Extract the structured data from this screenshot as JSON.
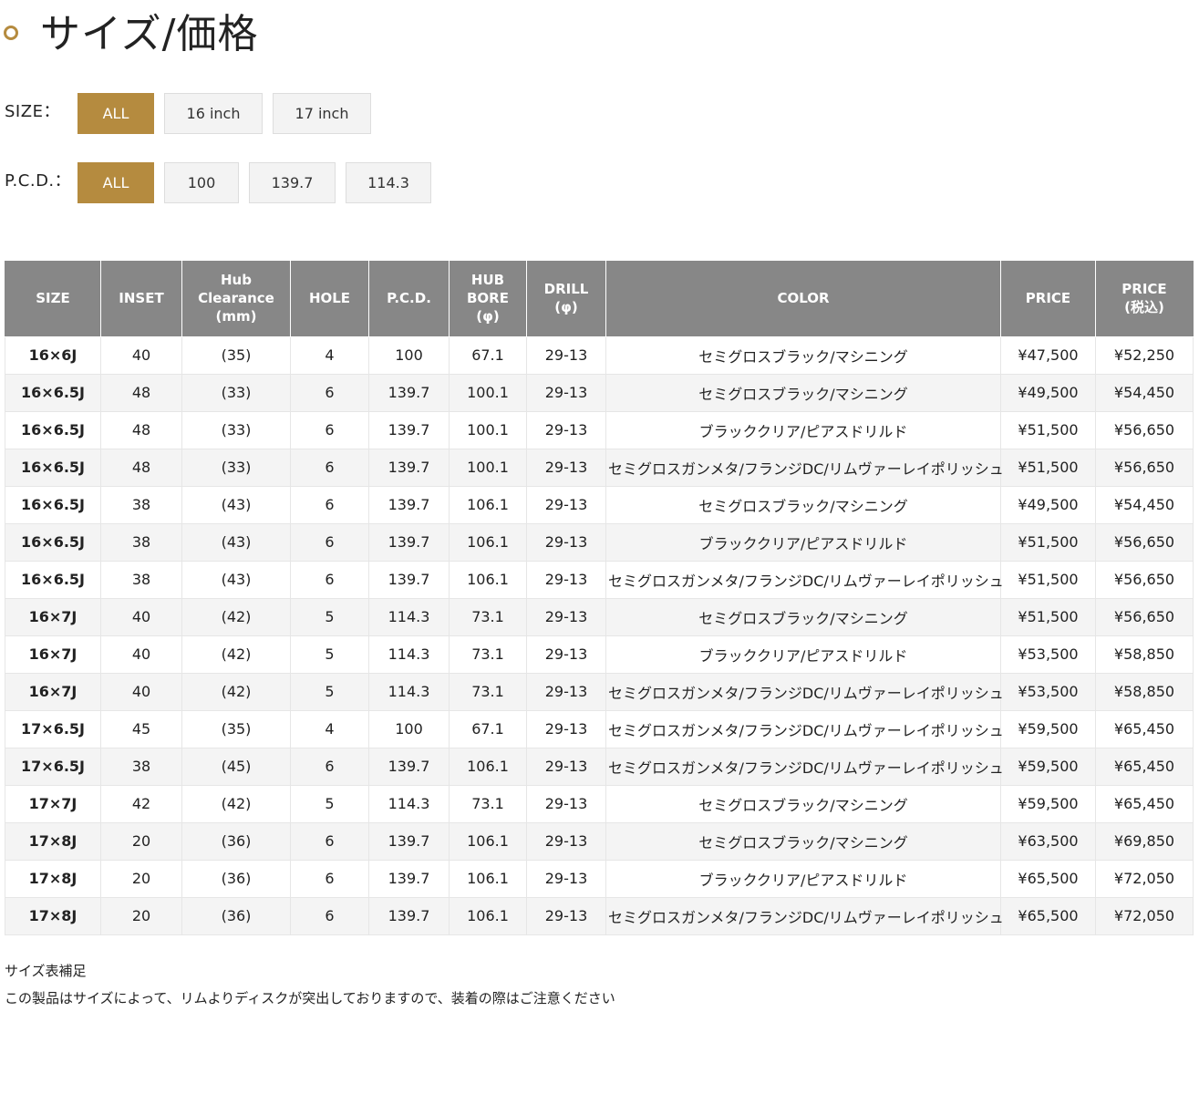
{
  "heading": {
    "icon": "circle-ring-icon",
    "title": "サイズ/価格"
  },
  "accent_color": "#b58b3f",
  "header_color": "#878787",
  "filters": {
    "size": {
      "label": "SIZE：",
      "options": [
        "ALL",
        "16 inch",
        "17 inch"
      ],
      "selected": "ALL"
    },
    "pcd": {
      "label": "P.C.D.：",
      "options": [
        "ALL",
        "100",
        "139.7",
        "114.3"
      ],
      "selected": "ALL"
    }
  },
  "table": {
    "headers": [
      [
        "SIZE"
      ],
      [
        "INSET"
      ],
      [
        "Hub",
        "Clearance",
        "(mm)"
      ],
      [
        "HOLE"
      ],
      [
        "P.C.D."
      ],
      [
        "HUB",
        "BORE",
        "(φ)"
      ],
      [
        "DRILL",
        "(φ)"
      ],
      [
        "COLOR"
      ],
      [
        "PRICE"
      ],
      [
        "PRICE",
        "(税込)"
      ]
    ],
    "rows": [
      [
        "16×6J",
        "40",
        "(35)",
        "4",
        "100",
        "67.1",
        "29-13",
        "セミグロスブラック/マシニング",
        "¥47,500",
        "¥52,250"
      ],
      [
        "16×6.5J",
        "48",
        "(33)",
        "6",
        "139.7",
        "100.1",
        "29-13",
        "セミグロスブラック/マシニング",
        "¥49,500",
        "¥54,450"
      ],
      [
        "16×6.5J",
        "48",
        "(33)",
        "6",
        "139.7",
        "100.1",
        "29-13",
        "ブラッククリア/ピアスドリルド",
        "¥51,500",
        "¥56,650"
      ],
      [
        "16×6.5J",
        "48",
        "(33)",
        "6",
        "139.7",
        "100.1",
        "29-13",
        "セミグロスガンメタ/フランジDC/リムヴァーレイポリッシュ",
        "¥51,500",
        "¥56,650"
      ],
      [
        "16×6.5J",
        "38",
        "(43)",
        "6",
        "139.7",
        "106.1",
        "29-13",
        "セミグロスブラック/マシニング",
        "¥49,500",
        "¥54,450"
      ],
      [
        "16×6.5J",
        "38",
        "(43)",
        "6",
        "139.7",
        "106.1",
        "29-13",
        "ブラッククリア/ピアスドリルド",
        "¥51,500",
        "¥56,650"
      ],
      [
        "16×6.5J",
        "38",
        "(43)",
        "6",
        "139.7",
        "106.1",
        "29-13",
        "セミグロスガンメタ/フランジDC/リムヴァーレイポリッシュ",
        "¥51,500",
        "¥56,650"
      ],
      [
        "16×7J",
        "40",
        "(42)",
        "5",
        "114.3",
        "73.1",
        "29-13",
        "セミグロスブラック/マシニング",
        "¥51,500",
        "¥56,650"
      ],
      [
        "16×7J",
        "40",
        "(42)",
        "5",
        "114.3",
        "73.1",
        "29-13",
        "ブラッククリア/ピアスドリルド",
        "¥53,500",
        "¥58,850"
      ],
      [
        "16×7J",
        "40",
        "(42)",
        "5",
        "114.3",
        "73.1",
        "29-13",
        "セミグロスガンメタ/フランジDC/リムヴァーレイポリッシュ",
        "¥53,500",
        "¥58,850"
      ],
      [
        "17×6.5J",
        "45",
        "(35)",
        "4",
        "100",
        "67.1",
        "29-13",
        "セミグロスガンメタ/フランジDC/リムヴァーレイポリッシュ",
        "¥59,500",
        "¥65,450"
      ],
      [
        "17×6.5J",
        "38",
        "(45)",
        "6",
        "139.7",
        "106.1",
        "29-13",
        "セミグロスガンメタ/フランジDC/リムヴァーレイポリッシュ",
        "¥59,500",
        "¥65,450"
      ],
      [
        "17×7J",
        "42",
        "(42)",
        "5",
        "114.3",
        "73.1",
        "29-13",
        "セミグロスブラック/マシニング",
        "¥59,500",
        "¥65,450"
      ],
      [
        "17×8J",
        "20",
        "(36)",
        "6",
        "139.7",
        "106.1",
        "29-13",
        "セミグロスブラック/マシニング",
        "¥63,500",
        "¥69,850"
      ],
      [
        "17×8J",
        "20",
        "(36)",
        "6",
        "139.7",
        "106.1",
        "29-13",
        "ブラッククリア/ピアスドリルド",
        "¥65,500",
        "¥72,050"
      ],
      [
        "17×8J",
        "20",
        "(36)",
        "6",
        "139.7",
        "106.1",
        "29-13",
        "セミグロスガンメタ/フランジDC/リムヴァーレイポリッシュ",
        "¥65,500",
        "¥72,050"
      ]
    ]
  },
  "notes": {
    "title": "サイズ表補足",
    "text": "この製品はサイズによって、リムよりディスクが突出しておりますので、装着の際はご注意ください"
  }
}
